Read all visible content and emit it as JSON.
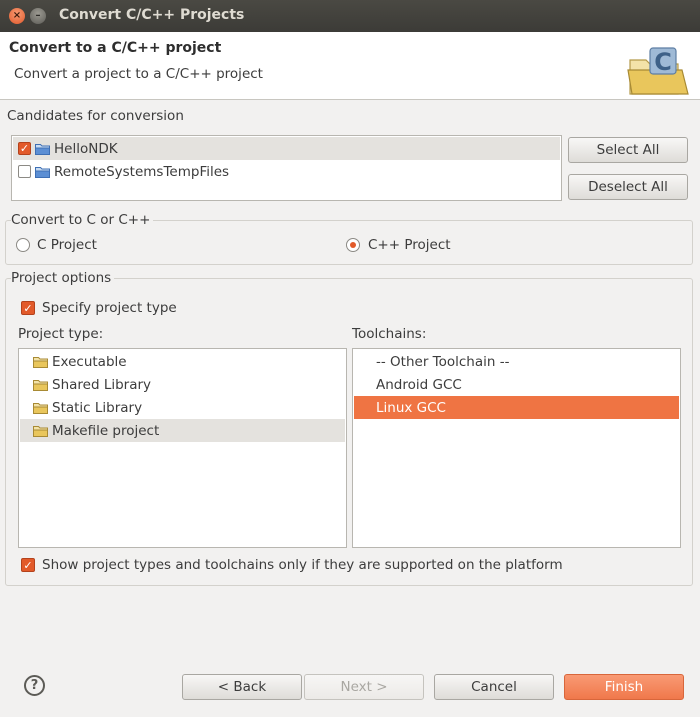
{
  "window": {
    "title": "Convert C/C++ Projects",
    "close_glyph": "×",
    "minimize_glyph": "–"
  },
  "banner": {
    "title": "Convert to a C/C++ project",
    "description": "Convert a project to a C/C++ project",
    "icon": "c-folder-wizard-icon"
  },
  "candidates": {
    "label": "Candidates for conversion",
    "items": [
      {
        "label": "HelloNDK",
        "checked": true,
        "selected": true
      },
      {
        "label": "RemoteSystemsTempFiles",
        "checked": false,
        "selected": false
      }
    ],
    "select_all": "Select All",
    "deselect_all": "Deselect All"
  },
  "convert": {
    "label": "Convert to C or C++",
    "c_project": "C Project",
    "cpp_project": "C++ Project",
    "selected": "cpp"
  },
  "options": {
    "label": "Project options",
    "specify_type": "Specify project type",
    "specify_checked": true,
    "project_type_label": "Project type:",
    "project_types": [
      "Executable",
      "Shared Library",
      "Static Library",
      "Makefile project"
    ],
    "project_type_selected": 3,
    "toolchains_label": "Toolchains:",
    "toolchains": [
      "-- Other Toolchain --",
      "Android GCC",
      "Linux GCC"
    ],
    "toolchain_selected": 2,
    "show_supported": "Show project types and toolchains only if they are supported on the platform",
    "show_supported_checked": true
  },
  "footer": {
    "help_glyph": "?",
    "back": "< Back",
    "next": "Next >",
    "cancel": "Cancel",
    "finish": "Finish"
  },
  "colors": {
    "accent": "#ef7443",
    "titlebar": "#3c3b37",
    "background": "#f2f1f0"
  }
}
